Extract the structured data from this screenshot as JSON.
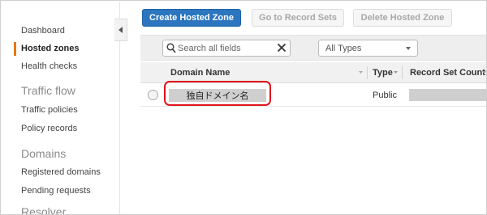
{
  "sidebar": {
    "items": [
      {
        "label": "Dashboard"
      },
      {
        "label": "Hosted zones",
        "active": true
      },
      {
        "label": "Health checks"
      }
    ],
    "sections": [
      {
        "heading": "Traffic flow",
        "items": [
          {
            "label": "Traffic policies"
          },
          {
            "label": "Policy records"
          }
        ]
      },
      {
        "heading": "Domains",
        "items": [
          {
            "label": "Registered domains"
          },
          {
            "label": "Pending requests"
          }
        ]
      },
      {
        "heading": "Resolver",
        "items": []
      }
    ],
    "accent_color": "#e47911"
  },
  "toolbar": {
    "create_label": "Create Hosted Zone",
    "goto_label": "Go to Record Sets",
    "delete_label": "Delete Hosted Zone",
    "primary_color": "#2b76bf"
  },
  "filter": {
    "search_placeholder": "Search all fields",
    "type_selected": "All Types"
  },
  "table": {
    "columns": [
      "Domain Name",
      "Type",
      "Record Set Count"
    ],
    "rows": [
      {
        "domain": "独自ドメイン名",
        "type": "Public",
        "record_set_count": ""
      }
    ],
    "highlight_color": "#e0141b"
  }
}
